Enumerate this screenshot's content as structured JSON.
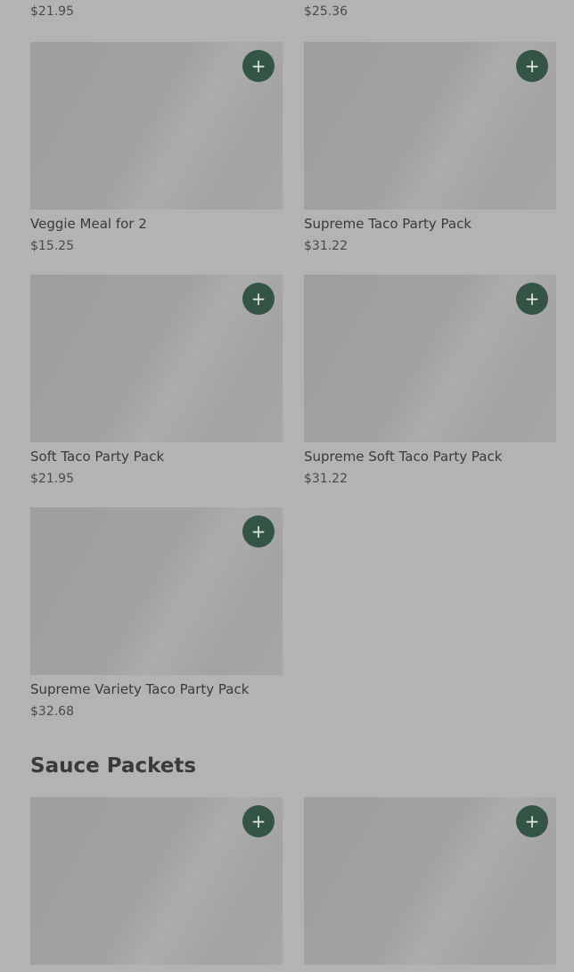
{
  "top_prices": [
    "$21.95",
    "$25.36"
  ],
  "add_icon": "plus-icon",
  "products": [
    {
      "name": "Veggie Meal for 2",
      "price": "$15.25"
    },
    {
      "name": "Supreme Taco Party Pack",
      "price": "$31.22"
    },
    {
      "name": "Soft Taco Party Pack",
      "price": "$21.95"
    },
    {
      "name": "Supreme Soft Taco Party Pack",
      "price": "$31.22"
    },
    {
      "name": "Supreme Variety Taco Party Pack",
      "price": "$32.68"
    }
  ],
  "sauce_section": {
    "title": "Sauce Packets"
  },
  "colors": {
    "overlay_background": "#b3b3b3",
    "add_button": "#345446"
  }
}
